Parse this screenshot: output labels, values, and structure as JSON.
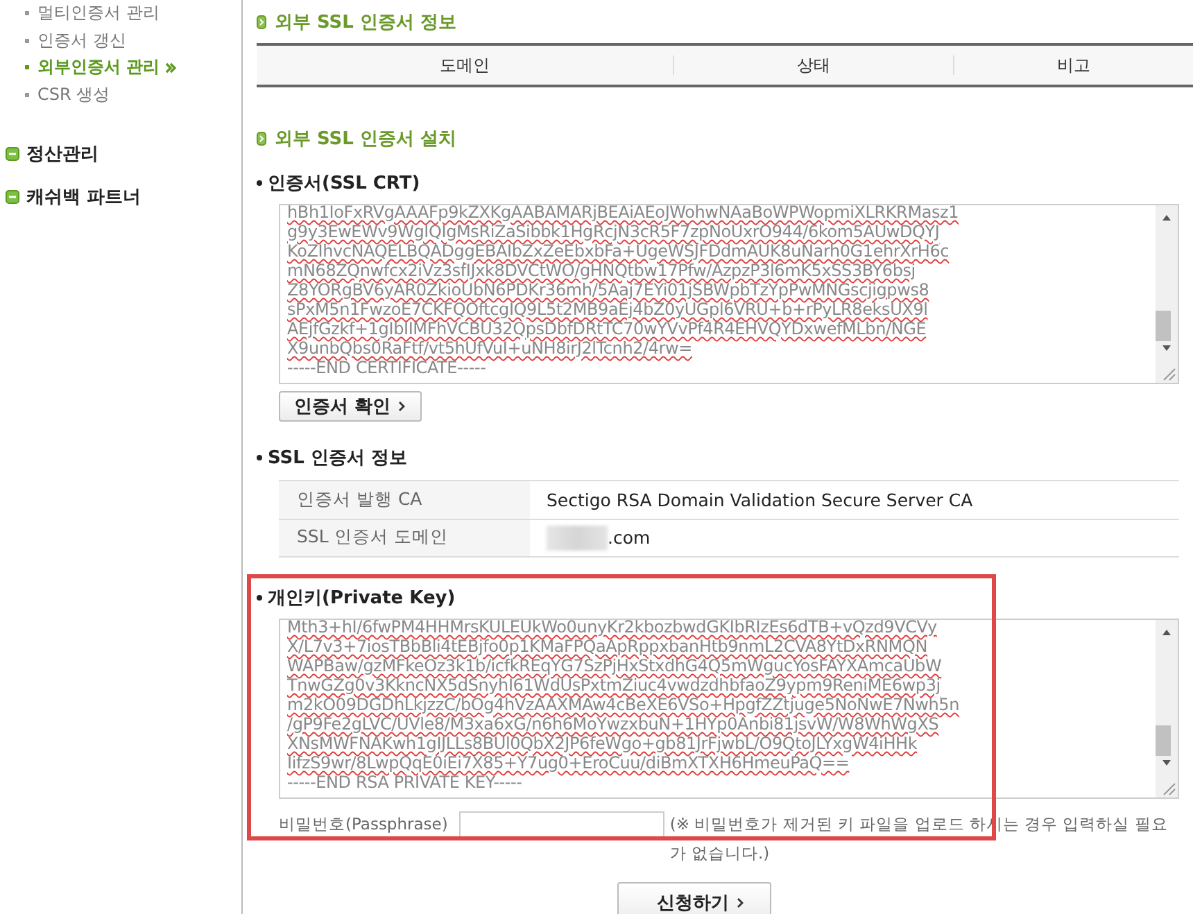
{
  "sidebar": {
    "sub_items": [
      {
        "label": "멀티인증서 관리",
        "selected": false
      },
      {
        "label": "인증서 갱신",
        "selected": false
      },
      {
        "label": "외부인증서 관리",
        "selected": true
      },
      {
        "label": "CSR 생성",
        "selected": false
      }
    ],
    "menus": [
      {
        "label": "정산관리"
      },
      {
        "label": "캐쉬백 파트너"
      }
    ]
  },
  "info_section": {
    "title": "외부 SSL 인증서 정보",
    "table": {
      "columns": [
        "도메인",
        "상태",
        "비고"
      ]
    }
  },
  "install_section": {
    "title": "외부 SSL 인증서 설치",
    "certificate": {
      "label": "인증서(SSL CRT)",
      "lines": [
        "hBh1IoFxRVgAAAFp9kZXKgAABAMARjBEAiAEoJWohwNAaBoWPWopmiXLRKRMasz1",
        "g9y3EwEWv9WgIQIgMsRiZaSibbk1HgRcjN3cR5F7zpNoUxrO944/6kom5AUwDQYJ",
        "KoZIhvcNAQELBQADggEBAIbZxZeEbxbFa+UgeWSJFDdmAUK8uNarh0G1ehrXrH6c",
        "mN68ZQnwfcx2iVz3sfIJxk8DVCtWO/gHNQtbw17Pfw/AzpzP3l6mK5xSS3BY6bsj",
        "Z8YORgBV6yAR0ZkioUbN6PDKr36mh/5Aaj7EYi01jSBWpbTzYpPwMNGscjigpws8",
        "sPxM5n1FwzoE7CKFQOftcgIQ9L5t2MB9aEj4bZ0yUGpl6VRU+b+rPyLR8eksUX9l",
        "AEjfGzkf+1gIbIIMFhVCBU32QpsDbfDRtTC70wYVvPf4R4EHVQYDxwefMLbn/NGE",
        "X9unbQbs0RaFtf/vt5hUfVuI+uNH8irJ2lTcnh2/4rw=",
        "-----END CERTIFICATE-----"
      ],
      "button": "인증서 확인"
    },
    "cert_info": {
      "label": "SSL 인증서 정보",
      "rows": [
        {
          "label": "인증서 발행 CA",
          "value": "Sectigo RSA Domain Validation Secure Server CA",
          "redacted": false
        },
        {
          "label": "SSL 인증서 도메인",
          "value": ".com",
          "redacted": true
        }
      ]
    },
    "private_key": {
      "label": "개인키(Private Key)",
      "highlighted": true,
      "lines": [
        "Mth3+hI/6fwPM4HHMrsKULEUkWo0unyKr2kbozbwdGKIbRIzEs6dTB+vQzd9VCVy",
        "X/L7v3+7iosTBbBli4tEBjfo0p1KMaFPQaApRppxbanHtb9nmL2CVA8YtDxRNMQN",
        "WAPBaw/gzMFkeOz3k1b/icfkREqYG7SzPjHxStxdhG4Q5mWgucYosFAYXAmcaUbW",
        "TnwGZg0v3KkncNX5dSnyhI61WdUsPxtmZiuc4vwdzdhbfaoZ9ypm9ReniME6wp3j",
        "m2kO09DGDhLkjzzC/bOg4hVzAAXMAw4cBeXE6VSo+HpgfZZtjuge5NoNwE7Nwh5n",
        "/gP9Fe2gLVC/UVle8/M3xa6xG/n6h6MoYwzxbuN+1HYp0Anbi81jsvW/W8WhWgXS",
        "XNsMWFNAKwh1gIJLLs8BUl0QbX2JP6feWgo+gb81JrFjwbL/O9QtoJLYxgW4iHHk",
        "IifzS9wr/8LwpQqE0iEi7X85+Y7ug0+EroCuu/diBmXTXH6HmeuPaQ==",
        "-----END RSA PRIVATE KEY-----"
      ]
    },
    "passphrase": {
      "label": "비밀번호(Passphrase)",
      "note": "(※ 비밀번호가 제거된 키 파일을 업로드 하시는 경우 입력하실 필요가 없습니다.)"
    },
    "submit": "신청하기"
  }
}
